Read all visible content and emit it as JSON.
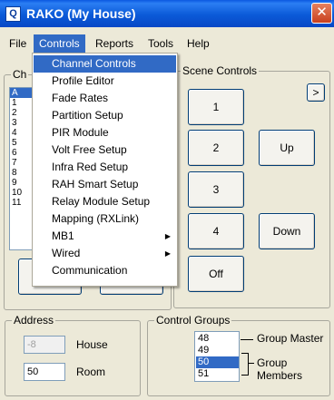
{
  "window": {
    "title": "RAKO (My House)",
    "app_icon": "rako-app-icon",
    "close_glyph": "✕"
  },
  "menubar": [
    "File",
    "Controls",
    "Reports",
    "Tools",
    "Help"
  ],
  "controls_menu": {
    "items": [
      "Channel Controls",
      "Profile Editor",
      "Fade Rates",
      "Partition Setup",
      "PIR Module",
      "Volt Free Setup",
      "Infra Red Setup",
      "RAH Smart Setup",
      "Relay Module Setup",
      "Mapping (RXLink)",
      "MB1",
      "Wired",
      "Communication"
    ],
    "submenu_arrow": "▶"
  },
  "channel_controls": {
    "legend_partial": "Ch",
    "list_rows": [
      "A",
      "1",
      "2",
      "3",
      "4",
      "5",
      "6",
      "7",
      "8",
      "9",
      "10",
      "11"
    ]
  },
  "scene_controls": {
    "legend": "Scene Controls",
    "scroll_button": ">",
    "buttons": [
      "1",
      "2",
      "Up",
      "3",
      "4",
      "Down",
      "Off"
    ]
  },
  "address": {
    "legend": "Address",
    "house_value": "-8",
    "house_label": "House",
    "room_value": "50",
    "room_label": "Room"
  },
  "control_groups": {
    "legend": "Control Groups",
    "list": [
      "48",
      "49",
      "50",
      "51"
    ],
    "group_master_label": "Group Master",
    "group_members_label": "Group Members"
  },
  "colors": {
    "selection": "#316AC5",
    "titlebar": "#0A58E0",
    "face": "#ECE9D8"
  }
}
